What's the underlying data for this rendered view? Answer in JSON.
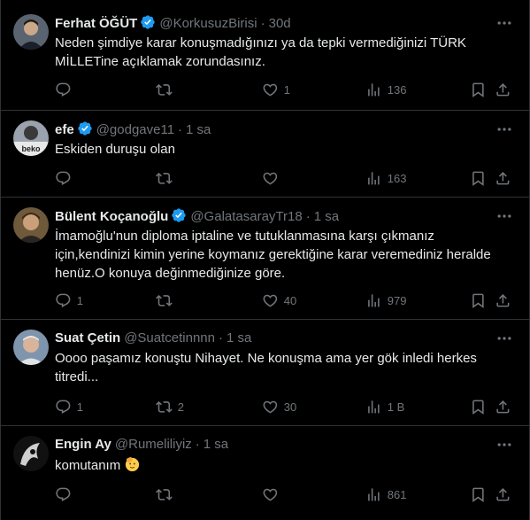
{
  "tweets": [
    {
      "name": "Ferhat ÖĞÜT",
      "verified": true,
      "handle": "@KorkusuzBirisi",
      "time": "30d",
      "text_lines": [
        "Neden şimdiye karar konuşmadığınızı ya da tepki vermediğinizi TÜRK",
        "MİLLETine açıklamak zorundasınız."
      ],
      "replies": "",
      "retweets": "",
      "likes": "1",
      "views": "136"
    },
    {
      "name": "efe",
      "verified": true,
      "handle": "@godgave11",
      "time": "1 sa",
      "text_lines": [
        "Eskiden duruşu olan"
      ],
      "replies": "",
      "retweets": "",
      "likes": "",
      "views": "163",
      "avatar_label": "beko"
    },
    {
      "name": "Bülent Koçanoğlu",
      "verified": true,
      "handle": "@GalatasarayTr18",
      "time": "1 sa",
      "text_lines": [
        "İmamoğlu'nun diploma iptaline ve tutuklanmasına karşı çıkmanız",
        "için,kendinizi kimin yerine koymanız gerektiğine karar veremediniz heralde",
        "henüz.O konuya değinmediğinize göre."
      ],
      "replies": "1",
      "retweets": "",
      "likes": "40",
      "views": "979"
    },
    {
      "name": "Suat Çetin",
      "verified": false,
      "handle": "@Suatcetinnnn",
      "time": "1 sa",
      "text_lines": [
        "Oooo paşamız konuştu Nihayet. Ne konuşma ama yer gök inledi herkes",
        "titredi..."
      ],
      "replies": "1",
      "retweets": "2",
      "likes": "30",
      "views": "1 B"
    },
    {
      "name": "Engin Ay",
      "verified": false,
      "handle": "@Rumeliliyiz",
      "time": "1 sa",
      "text_lines": [
        "komutanım"
      ],
      "replies": "",
      "retweets": "",
      "likes": "",
      "views": "861"
    }
  ],
  "separator": "·",
  "colors": {
    "background": "#000000",
    "text": "#e7e9ea",
    "muted": "#71767b",
    "verified": "#1d9bf0",
    "divider": "#2f3336"
  }
}
